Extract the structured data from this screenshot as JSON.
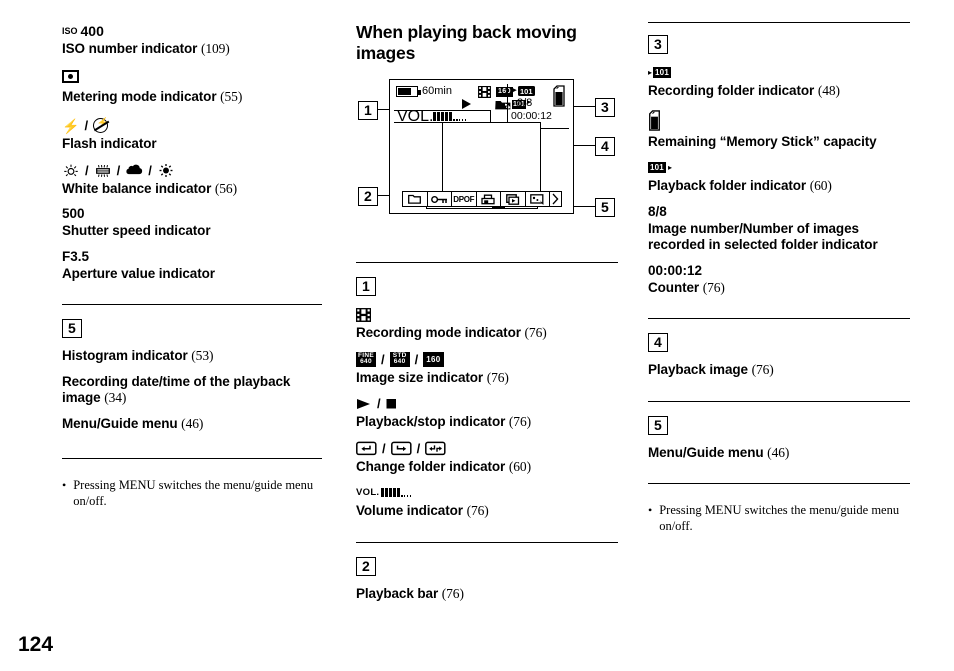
{
  "page": {
    "number": "124"
  },
  "left_column": {
    "entries": [
      {
        "icon": "iso-400-indicator",
        "value_small": "ISO",
        "value_large": "400",
        "label": "ISO number indicator",
        "page_ref": "(109)"
      },
      {
        "icon": "metering-mode-icon",
        "label": "Metering mode indicator",
        "page_ref": "(55)"
      },
      {
        "icon": "flash-icons",
        "label": "Flash indicator",
        "page_ref": ""
      },
      {
        "icon": "white-balance-icons",
        "label": "White balance indicator",
        "page_ref": "(56)"
      },
      {
        "icon": "shutter-speed-value",
        "value": "500",
        "label": "Shutter speed indicator",
        "page_ref": ""
      },
      {
        "icon": "aperture-value",
        "value": "F3.5",
        "label": "Aperture value indicator",
        "page_ref": ""
      }
    ],
    "section5": {
      "number": "5",
      "items": [
        {
          "label": "Histogram indicator",
          "page_ref": "(53)"
        },
        {
          "label": "Recording date/time of the playback image",
          "page_ref": "(34)"
        },
        {
          "label": "Menu/Guide menu",
          "page_ref": "(46)"
        }
      ]
    },
    "note": "Pressing MENU switches the menu/guide menu on/off.",
    "note_bullet": "•"
  },
  "middle_column": {
    "heading": "When playing back moving images",
    "lcd": {
      "battery_time": "60min",
      "image_size": "160",
      "playback_folder": "101",
      "recording_folder": "101",
      "image_count": "8/8",
      "counter": "00:00:12",
      "volume_label": "VOL.",
      "volume_filled": 5,
      "volume_empty": 5,
      "menu_items": [
        "folder-icon",
        "protect-key-icon",
        "DPOF",
        "print-icon",
        "slideshow-icon",
        "resize-icon",
        "more-arrow-icon"
      ],
      "dpof_label": "DPOF",
      "callouts": [
        "1",
        "2",
        "3",
        "4",
        "5"
      ]
    },
    "section1": {
      "number": "1",
      "entries": [
        {
          "icon": "movie-recording-mode-icon",
          "label": "Recording mode indicator",
          "page_ref": "(76)"
        },
        {
          "icon": "image-size-chips",
          "chips": [
            [
              "FINE",
              "640"
            ],
            [
              "STD",
              "640"
            ],
            [
              "160"
            ]
          ],
          "label": "Image size indicator",
          "page_ref": "(76)"
        },
        {
          "icon": "playback-stop-icons",
          "label": "Playback/stop indicator",
          "page_ref": "(76)"
        },
        {
          "icon": "change-folder-icons",
          "label": "Change folder indicator",
          "page_ref": "(60)"
        },
        {
          "icon": "volume-indicator-icon",
          "volume_label": "VOL.",
          "label": "Volume indicator",
          "page_ref": "(76)"
        }
      ]
    },
    "section2": {
      "number": "2",
      "label": "Playback bar",
      "page_ref": "(76)"
    }
  },
  "right_column": {
    "section3": {
      "number": "3",
      "entries": [
        {
          "icon": "recording-folder-chip",
          "chip": "101",
          "label": "Recording folder indicator",
          "page_ref": "(48)"
        },
        {
          "icon": "memory-stick-icon",
          "label": "Remaining “Memory Stick” capacity",
          "page_ref": ""
        },
        {
          "icon": "playback-folder-chip",
          "chip": "101",
          "label": "Playback folder indicator",
          "page_ref": "(60)"
        },
        {
          "icon": "image-number-value",
          "value": "8/8",
          "label": "Image number/Number of images recorded in selected folder indicator",
          "page_ref": ""
        },
        {
          "icon": "counter-value",
          "value": "00:00:12",
          "label": "Counter",
          "page_ref": "(76)"
        }
      ]
    },
    "section4": {
      "number": "4",
      "label": "Playback image",
      "page_ref": "(76)"
    },
    "section5": {
      "number": "5",
      "label": "Menu/Guide menu",
      "page_ref": "(46)"
    },
    "note": "Pressing MENU switches the menu/guide menu on/off.",
    "note_bullet": "•"
  }
}
